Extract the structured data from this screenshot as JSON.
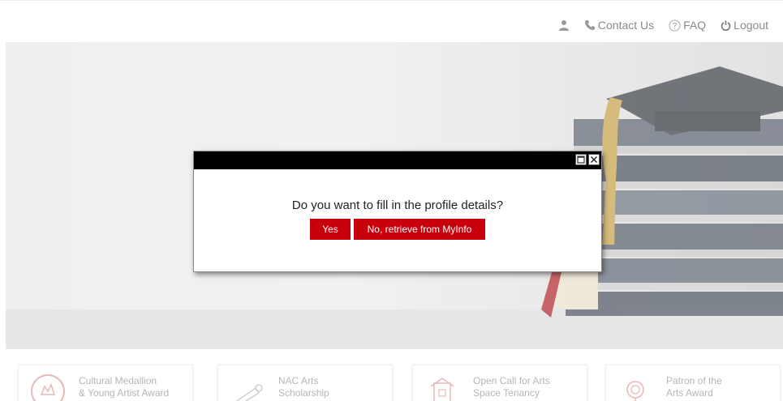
{
  "nav": {
    "contact_label": "Contact Us",
    "faq_label": "FAQ",
    "logout_label": "Logout"
  },
  "modal": {
    "question": "Do you want to fill in the profile details?",
    "yes_label": "Yes",
    "myinfo_label": "No, retrieve from MyInfo"
  },
  "cards": [
    {
      "title": "Cultural Medallion",
      "subtitle": "& Young Artist Award",
      "icon": "medallion-icon"
    },
    {
      "title": "NAC Arts",
      "subtitle": "Scholarship",
      "icon": "telescope-icon"
    },
    {
      "title": "Open Call for Arts",
      "subtitle": "Space Tenancy",
      "icon": "building-icon"
    },
    {
      "title": "Patron of the",
      "subtitle": "Arts Award",
      "icon": "rose-icon"
    }
  ],
  "colors": {
    "accent_red": "#c8000c",
    "nav_gray": "#8a8a8a",
    "modal_header": "#000000"
  }
}
